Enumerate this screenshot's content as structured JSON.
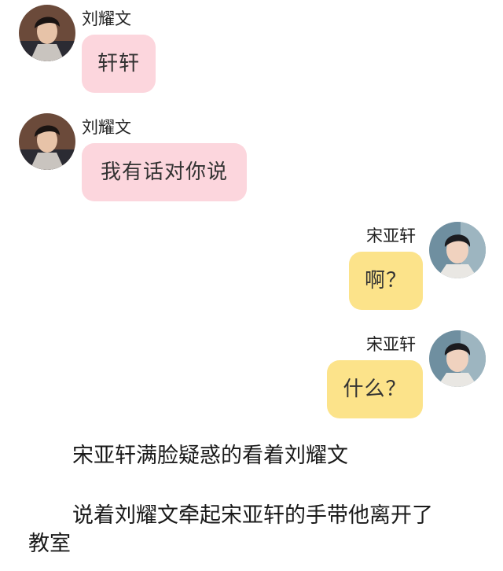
{
  "messages": [
    {
      "side": "left",
      "sender": "刘耀文",
      "text": "轩轩"
    },
    {
      "side": "left",
      "sender": "刘耀文",
      "text": "我有话对你说"
    },
    {
      "side": "right",
      "sender": "宋亚轩",
      "text": "啊？"
    },
    {
      "side": "right",
      "sender": "宋亚轩",
      "text": "什么？"
    }
  ],
  "narration": {
    "line1": "宋亚轩满脸疑惑的看着刘耀文",
    "line2a": "说着刘耀文牵起宋亚轩的手带他离开了",
    "line2b": "教室"
  },
  "colors": {
    "left_bubble": "#fcd6dd",
    "right_bubble": "#fce38a"
  }
}
